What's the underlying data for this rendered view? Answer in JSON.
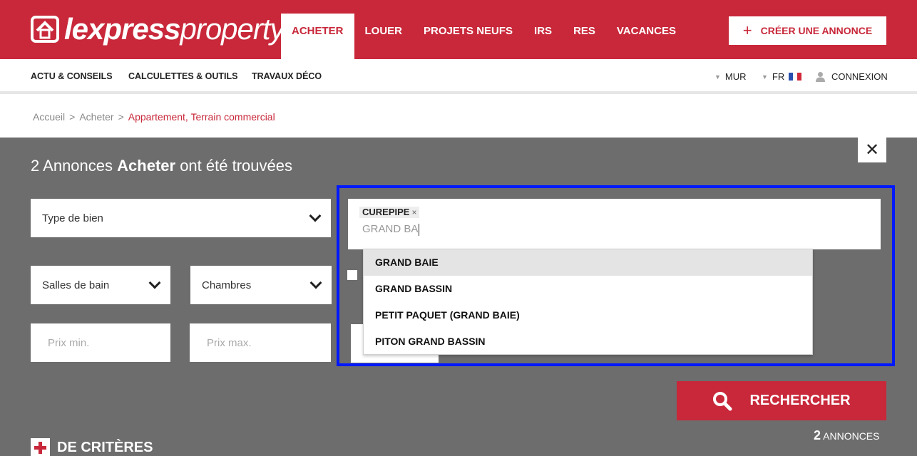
{
  "header": {
    "logo_bold": "lexpress",
    "logo_light": "property",
    "brand_color": "#c8283a",
    "nav": [
      {
        "label": "ACHETER",
        "active": true
      },
      {
        "label": "LOUER",
        "active": false
      },
      {
        "label": "PROJETS NEUFS",
        "active": false
      },
      {
        "label": "IRS",
        "active": false
      },
      {
        "label": "RES",
        "active": false
      },
      {
        "label": "VACANCES",
        "active": false
      }
    ],
    "create_ad": "CRÉER UNE ANNONCE"
  },
  "subnav": {
    "links": [
      "ACTU & CONSEILS",
      "CALCULETTES & OUTILS",
      "TRAVAUX DÉCO"
    ],
    "currency": "MUR",
    "language": "FR",
    "login": "CONNEXION"
  },
  "breadcrumb": {
    "home": "Accueil",
    "buy": "Acheter",
    "current": "Appartement, Terrain commercial",
    "separator": ">"
  },
  "search": {
    "results_count": "2",
    "results_prefix": "Annonces",
    "results_category": "Acheter",
    "results_suffix": "ont été trouvées",
    "property_type_placeholder": "Type de bien",
    "bathrooms_placeholder": "Salles de bain",
    "bedrooms_placeholder": "Chambres",
    "price_min_placeholder": "Prix min.",
    "price_max_placeholder": "Prix max.",
    "location_tags": [
      "CUREPIPE"
    ],
    "location_query": "GRAND BA",
    "suggestions": [
      "GRAND BAIE",
      "GRAND BASSIN",
      "PETIT PAQUET (GRAND BAIE)",
      "PITON GRAND BASSIN"
    ],
    "search_button": "RECHERCHER",
    "count_label": "ANNONCES",
    "more_criteria": "DE CRITÈRES"
  }
}
